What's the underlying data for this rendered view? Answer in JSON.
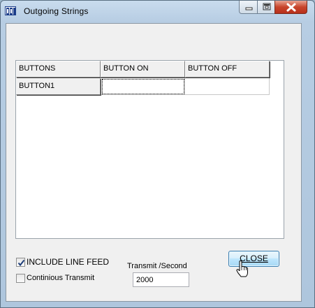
{
  "window": {
    "title": "Outgoing  Strings"
  },
  "grid": {
    "headers": [
      "BUTTONS",
      "BUTTON ON",
      "BUTTON OFF"
    ],
    "rows": [
      {
        "name": "BUTTON1",
        "on": "",
        "off": ""
      }
    ]
  },
  "options": {
    "include_line_feed": {
      "label": "INCLUDE LINE FEED",
      "checked": true
    },
    "continuous_transmit": {
      "label": "Continious Transmit",
      "checked": false
    }
  },
  "transmit": {
    "label": "Transmit /Second",
    "value": "2000"
  },
  "close_button": {
    "label": "CLOSE"
  },
  "icons": {
    "app": "app-icon",
    "minimize": "minimize-icon",
    "maximize": "maximize-icon",
    "close": "close-icon",
    "check": "check-icon",
    "cursor": "hand-pointer-icon"
  }
}
